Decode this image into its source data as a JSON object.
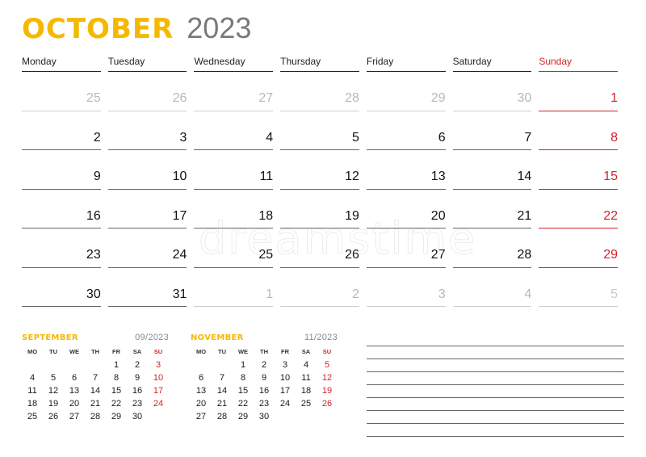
{
  "header": {
    "month": "OCTOBER",
    "year": "2023"
  },
  "colors": {
    "accent": "#f5b800",
    "sunday": "#d2232a",
    "muted": "#b8b8b8",
    "year": "#7a7a7a"
  },
  "weekdays": [
    "Monday",
    "Tuesday",
    "Wednesday",
    "Thursday",
    "Friday",
    "Saturday",
    "Sunday"
  ],
  "weeks": [
    [
      {
        "d": "25",
        "o": true
      },
      {
        "d": "26",
        "o": true
      },
      {
        "d": "27",
        "o": true
      },
      {
        "d": "28",
        "o": true
      },
      {
        "d": "29",
        "o": true
      },
      {
        "d": "30",
        "o": true
      },
      {
        "d": "1",
        "o": false
      }
    ],
    [
      {
        "d": "2",
        "o": false
      },
      {
        "d": "3",
        "o": false
      },
      {
        "d": "4",
        "o": false
      },
      {
        "d": "5",
        "o": false
      },
      {
        "d": "6",
        "o": false
      },
      {
        "d": "7",
        "o": false
      },
      {
        "d": "8",
        "o": false
      }
    ],
    [
      {
        "d": "9",
        "o": false
      },
      {
        "d": "10",
        "o": false
      },
      {
        "d": "11",
        "o": false
      },
      {
        "d": "12",
        "o": false
      },
      {
        "d": "13",
        "o": false
      },
      {
        "d": "14",
        "o": false
      },
      {
        "d": "15",
        "o": false
      }
    ],
    [
      {
        "d": "16",
        "o": false
      },
      {
        "d": "17",
        "o": false
      },
      {
        "d": "18",
        "o": false
      },
      {
        "d": "19",
        "o": false
      },
      {
        "d": "20",
        "o": false
      },
      {
        "d": "21",
        "o": false
      },
      {
        "d": "22",
        "o": false
      }
    ],
    [
      {
        "d": "23",
        "o": false
      },
      {
        "d": "24",
        "o": false
      },
      {
        "d": "25",
        "o": false
      },
      {
        "d": "26",
        "o": false
      },
      {
        "d": "27",
        "o": false
      },
      {
        "d": "28",
        "o": false
      },
      {
        "d": "29",
        "o": false
      }
    ],
    [
      {
        "d": "30",
        "o": false
      },
      {
        "d": "31",
        "o": false
      },
      {
        "d": "1",
        "o": true
      },
      {
        "d": "2",
        "o": true
      },
      {
        "d": "3",
        "o": true
      },
      {
        "d": "4",
        "o": true
      },
      {
        "d": "5",
        "o": true
      }
    ]
  ],
  "mini_calendars": [
    {
      "name": "SEPTEMBER",
      "code": "09/2023",
      "dow": [
        "MO",
        "TU",
        "WE",
        "TH",
        "FR",
        "SA",
        "SU"
      ],
      "weeks": [
        [
          "",
          "",
          "",
          "",
          "1",
          "2",
          "3"
        ],
        [
          "4",
          "5",
          "6",
          "7",
          "8",
          "9",
          "10"
        ],
        [
          "11",
          "12",
          "13",
          "14",
          "15",
          "16",
          "17"
        ],
        [
          "18",
          "19",
          "20",
          "21",
          "22",
          "23",
          "24"
        ],
        [
          "25",
          "26",
          "27",
          "28",
          "29",
          "30",
          ""
        ]
      ]
    },
    {
      "name": "NOVEMBER",
      "code": "11/2023",
      "dow": [
        "MO",
        "TU",
        "WE",
        "TH",
        "FR",
        "SA",
        "SU"
      ],
      "weeks": [
        [
          "",
          "",
          "1",
          "2",
          "3",
          "4",
          "5"
        ],
        [
          "6",
          "7",
          "8",
          "9",
          "10",
          "11",
          "12"
        ],
        [
          "13",
          "14",
          "15",
          "16",
          "17",
          "18",
          "19"
        ],
        [
          "20",
          "21",
          "22",
          "23",
          "24",
          "25",
          "26"
        ],
        [
          "27",
          "28",
          "29",
          "30",
          "",
          "",
          ""
        ]
      ]
    }
  ],
  "notes": {
    "line_count": 8
  },
  "watermark": "dreamstime"
}
